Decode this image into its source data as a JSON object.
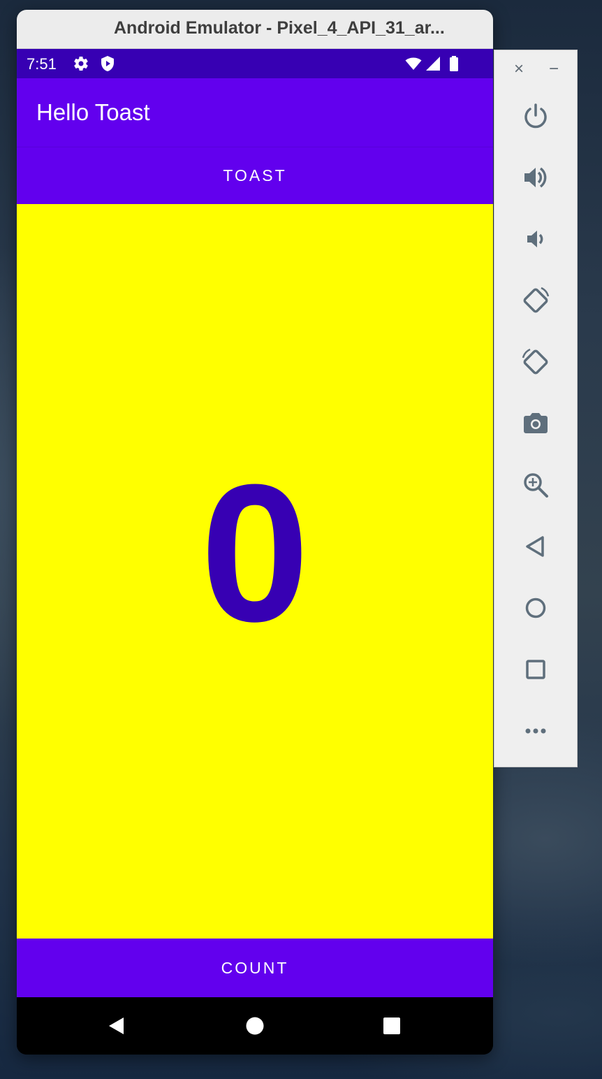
{
  "window": {
    "title": "Android Emulator - Pixel_4_API_31_ar..."
  },
  "status_bar": {
    "time": "7:51",
    "icons": [
      "settings-icon",
      "shield-play-icon",
      "wifi-icon",
      "signal-icon",
      "battery-icon"
    ]
  },
  "app_bar": {
    "title": "Hello Toast"
  },
  "buttons": {
    "toast_label": "TOAST",
    "count_label": "COUNT"
  },
  "main": {
    "count": "0"
  },
  "nav_bar": {
    "icons": [
      "back-icon",
      "home-icon",
      "recents-icon"
    ]
  },
  "side_panel": {
    "buttons": [
      "power-icon",
      "volume-up-icon",
      "volume-down-icon",
      "rotate-left-icon",
      "rotate-right-icon",
      "camera-icon",
      "zoom-icon",
      "back-icon",
      "home-icon",
      "overview-icon",
      "more-icon"
    ]
  },
  "colors": {
    "primary": "#6200ee",
    "primary_dark": "#3700b3",
    "background": "#ffff00",
    "on_primary": "#ffffff"
  }
}
